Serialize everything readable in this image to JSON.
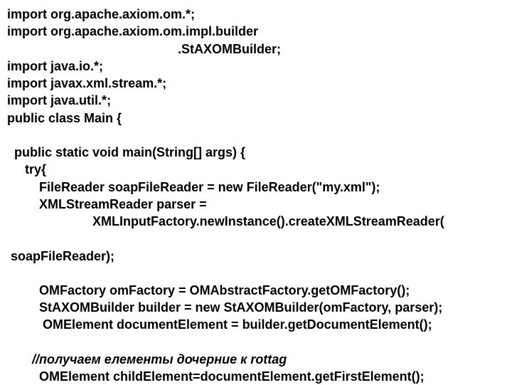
{
  "code": {
    "l1": "import org.apache.axiom.om.*;",
    "l2": "import org.apache.axiom.om.impl.builder",
    "l3": "                                                .StAXOMBuilder;",
    "l4": "import java.io.*;",
    "l5": "import javax.xml.stream.*;",
    "l6": "import java.util.*;",
    "l7": "public class Main {",
    "l8": "  public static void main(String[] args) {",
    "l9": "     try{",
    "l10": "         FileReader soapFileReader = new FileReader(\"my.xml\");",
    "l11": "         XMLStreamReader parser =",
    "l12": "                        XMLInputFactory.newInstance().createXMLStreamReader(",
    "l13": " soapFileReader);",
    "l14": "         OMFactory omFactory = OMAbstractFactory.getOMFactory();",
    "l15": "         StAXOMBuilder builder = new StAXOMBuilder(omFactory, parser);",
    "l16": "          OMElement documentElement = builder.getDocumentElement();",
    "l17": "       //получаем елементы дочерние к rottag",
    "l18": "         OMElement childElement=documentElement.getFirstElement();"
  }
}
